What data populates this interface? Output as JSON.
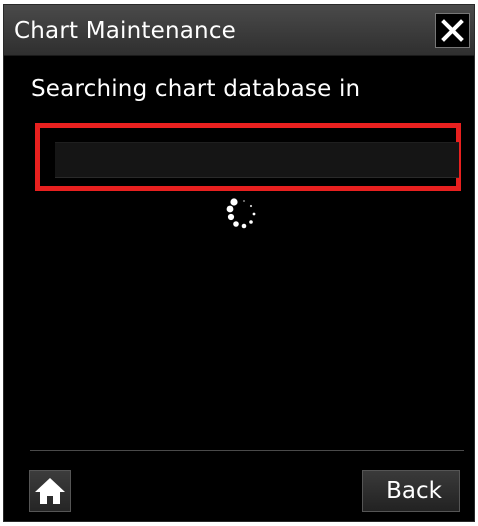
{
  "window": {
    "title": "Chart Maintenance",
    "close_icon": "close-icon"
  },
  "main": {
    "status_text": "Searching chart database in",
    "path_value": "",
    "spinner_icon": "loading-spinner-icon"
  },
  "footer": {
    "home_icon": "home-icon",
    "back_label": "Back"
  },
  "colors": {
    "background": "#000000",
    "title_bar": "#3a3a3a",
    "highlight": "#e8201f",
    "text": "#ffffff"
  }
}
